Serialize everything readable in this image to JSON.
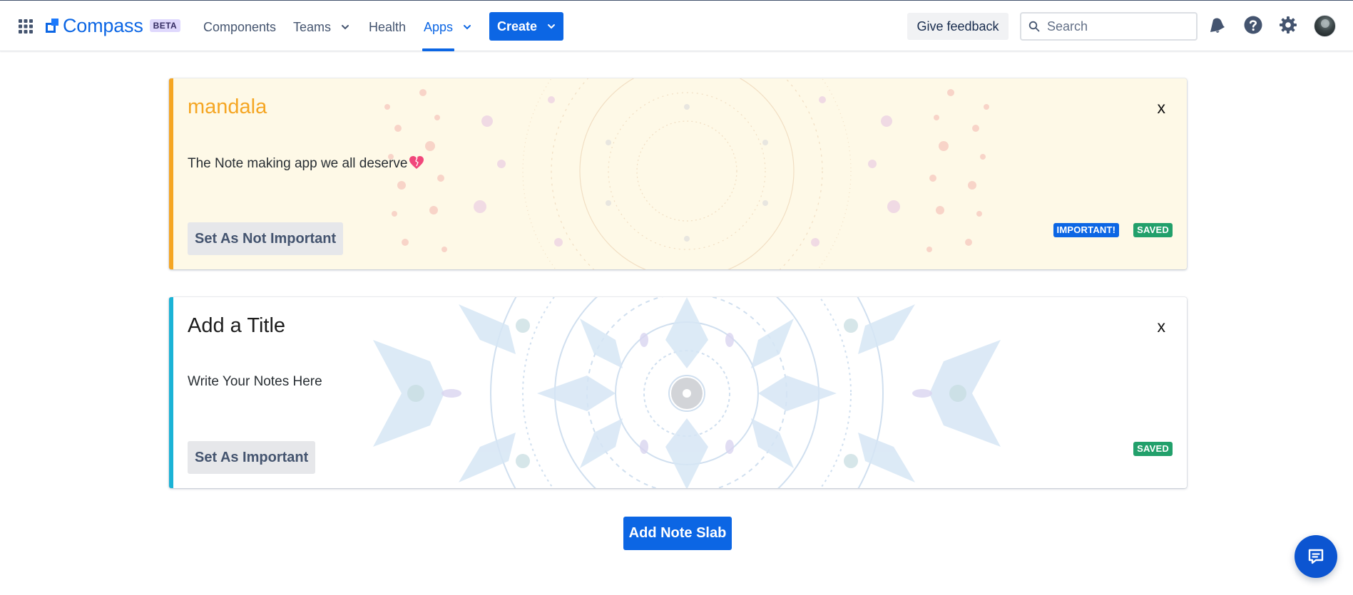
{
  "header": {
    "brand": "Compass",
    "brand_badge": "BETA",
    "nav": [
      {
        "label": "Components"
      },
      {
        "label": "Teams"
      },
      {
        "label": "Health"
      },
      {
        "label": "Apps"
      }
    ],
    "active_nav": "Apps",
    "create_label": "Create",
    "feedback_label": "Give feedback",
    "search_placeholder": "Search",
    "icons": [
      "app-switcher-icon",
      "notifications-icon",
      "help-icon",
      "settings-icon",
      "avatar"
    ]
  },
  "notes": [
    {
      "title": "mandala",
      "body": "The Note making app we all deserve",
      "body_emoji": "heart-icon",
      "close_label": "x",
      "toggle_label": "Set As Not Important",
      "badges": [
        "IMPORTANT!",
        "SAVED"
      ],
      "accent": "#f5a623",
      "background": "#fef9e7"
    },
    {
      "title": "Add a Title",
      "body": "Write Your Notes Here",
      "close_label": "x",
      "toggle_label": "Set As Important",
      "badges": [
        "SAVED"
      ],
      "accent": "#1bb3d6",
      "background": "#ffffff"
    }
  ],
  "add_button_label": "Add Note Slab",
  "colors": {
    "primary": "#0c66e4",
    "saved_badge": "#22a06b",
    "important_badge": "#0c66e4"
  }
}
